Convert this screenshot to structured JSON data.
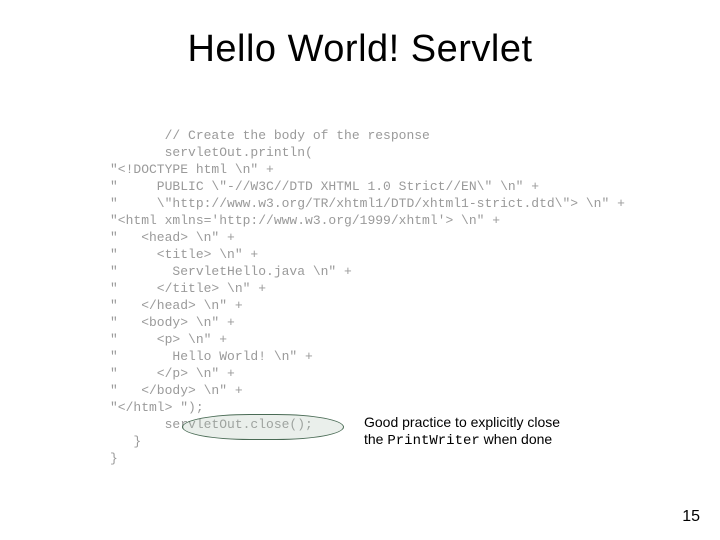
{
  "slide": {
    "title": "Hello World! Servlet",
    "page_number": "15"
  },
  "code": {
    "lines": [
      "       // Create the body of the response",
      "       servletOut.println(",
      "\"<!DOCTYPE html \\n\" +",
      "\"     PUBLIC \\\"-//W3C//DTD XHTML 1.0 Strict//EN\\\" \\n\" +",
      "\"     \\\"http://www.w3.org/TR/xhtml1/DTD/xhtml1-strict.dtd\\\"> \\n\" +",
      "\"<html xmlns='http://www.w3.org/1999/xhtml'> \\n\" +",
      "\"   <head> \\n\" +",
      "\"     <title> \\n\" +",
      "\"       ServletHello.java \\n\" +",
      "\"     </title> \\n\" +",
      "\"   </head> \\n\" +",
      "\"   <body> \\n\" +",
      "\"     <p> \\n\" +",
      "\"       Hello World! \\n\" +",
      "\"     </p> \\n\" +",
      "\"   </body> \\n\" +",
      "\"</html> \");",
      "       servletOut.close();",
      "   }",
      "}"
    ]
  },
  "callout": {
    "line1": "Good practice to explicitly close",
    "line2_pre": "the ",
    "line2_mono": "PrintWriter",
    "line2_post": " when done"
  }
}
